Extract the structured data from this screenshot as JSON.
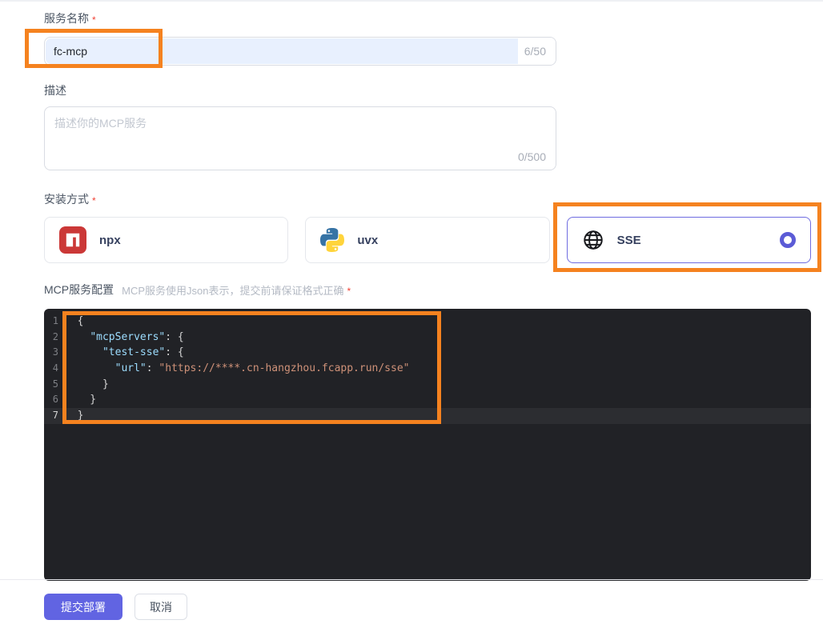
{
  "page": {
    "accent_color": "#6164e2",
    "annotation_color": "#f5821f",
    "autofill_color": "#e8f0fe"
  },
  "name_field": {
    "label": "服务名称",
    "required_marker": "*",
    "value": "fc-mcp",
    "counter": "6/50"
  },
  "desc_field": {
    "label": "描述",
    "placeholder": "描述你的MCP服务",
    "counter": "0/500"
  },
  "install": {
    "label": "安装方式",
    "required_marker": "*",
    "options": [
      {
        "label": "npx",
        "icon": "npm-icon",
        "selected": false
      },
      {
        "label": "uvx",
        "icon": "python-icon",
        "selected": false
      },
      {
        "label": "SSE",
        "icon": "globe-icon",
        "selected": true
      }
    ]
  },
  "config_section": {
    "label": "MCP服务配置",
    "hint": "MCP服务使用Json表示，提交前请保证格式正确",
    "required_marker": "*"
  },
  "editor": {
    "language": "json",
    "current_line": 7,
    "lines": [
      {
        "num": "1",
        "segments": [
          {
            "text": "  {",
            "type": "punct"
          }
        ]
      },
      {
        "num": "2",
        "segments": [
          {
            "text": "    ",
            "type": "punct"
          },
          {
            "text": "\"mcpServers\"",
            "type": "key"
          },
          {
            "text": ": {",
            "type": "punct"
          }
        ]
      },
      {
        "num": "3",
        "segments": [
          {
            "text": "      ",
            "type": "punct"
          },
          {
            "text": "\"test-sse\"",
            "type": "key"
          },
          {
            "text": ": {",
            "type": "punct"
          }
        ]
      },
      {
        "num": "4",
        "segments": [
          {
            "text": "        ",
            "type": "punct"
          },
          {
            "text": "\"url\"",
            "type": "key"
          },
          {
            "text": ": ",
            "type": "punct"
          },
          {
            "text": "\"https://****.cn-hangzhou.fcapp.run/sse\"",
            "type": "string"
          }
        ]
      },
      {
        "num": "5",
        "segments": [
          {
            "text": "      }",
            "type": "punct"
          }
        ]
      },
      {
        "num": "6",
        "segments": [
          {
            "text": "    }",
            "type": "punct"
          }
        ]
      },
      {
        "num": "7",
        "segments": [
          {
            "text": "  }",
            "type": "punct"
          }
        ]
      }
    ]
  },
  "actions": {
    "submit": "提交部署",
    "cancel": "取消"
  }
}
